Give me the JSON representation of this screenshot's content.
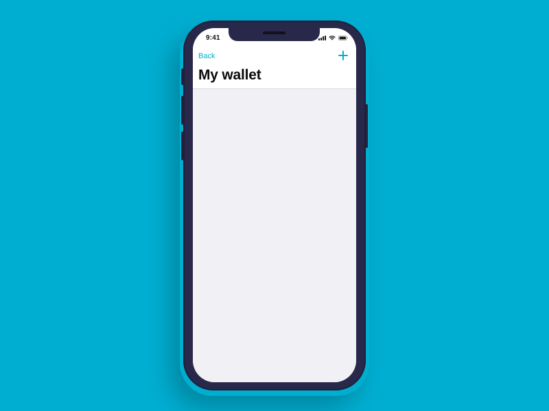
{
  "status_bar": {
    "time": "9:41",
    "icons": [
      "signal-icon",
      "wifi-icon",
      "battery-icon"
    ]
  },
  "nav": {
    "back_label": "Back",
    "add_icon": "plus-icon"
  },
  "page": {
    "title": "My wallet"
  },
  "colors": {
    "background": "#00aed1",
    "accent": "#00aed1",
    "device": "#28284a",
    "content_bg": "#f0f0f5"
  }
}
